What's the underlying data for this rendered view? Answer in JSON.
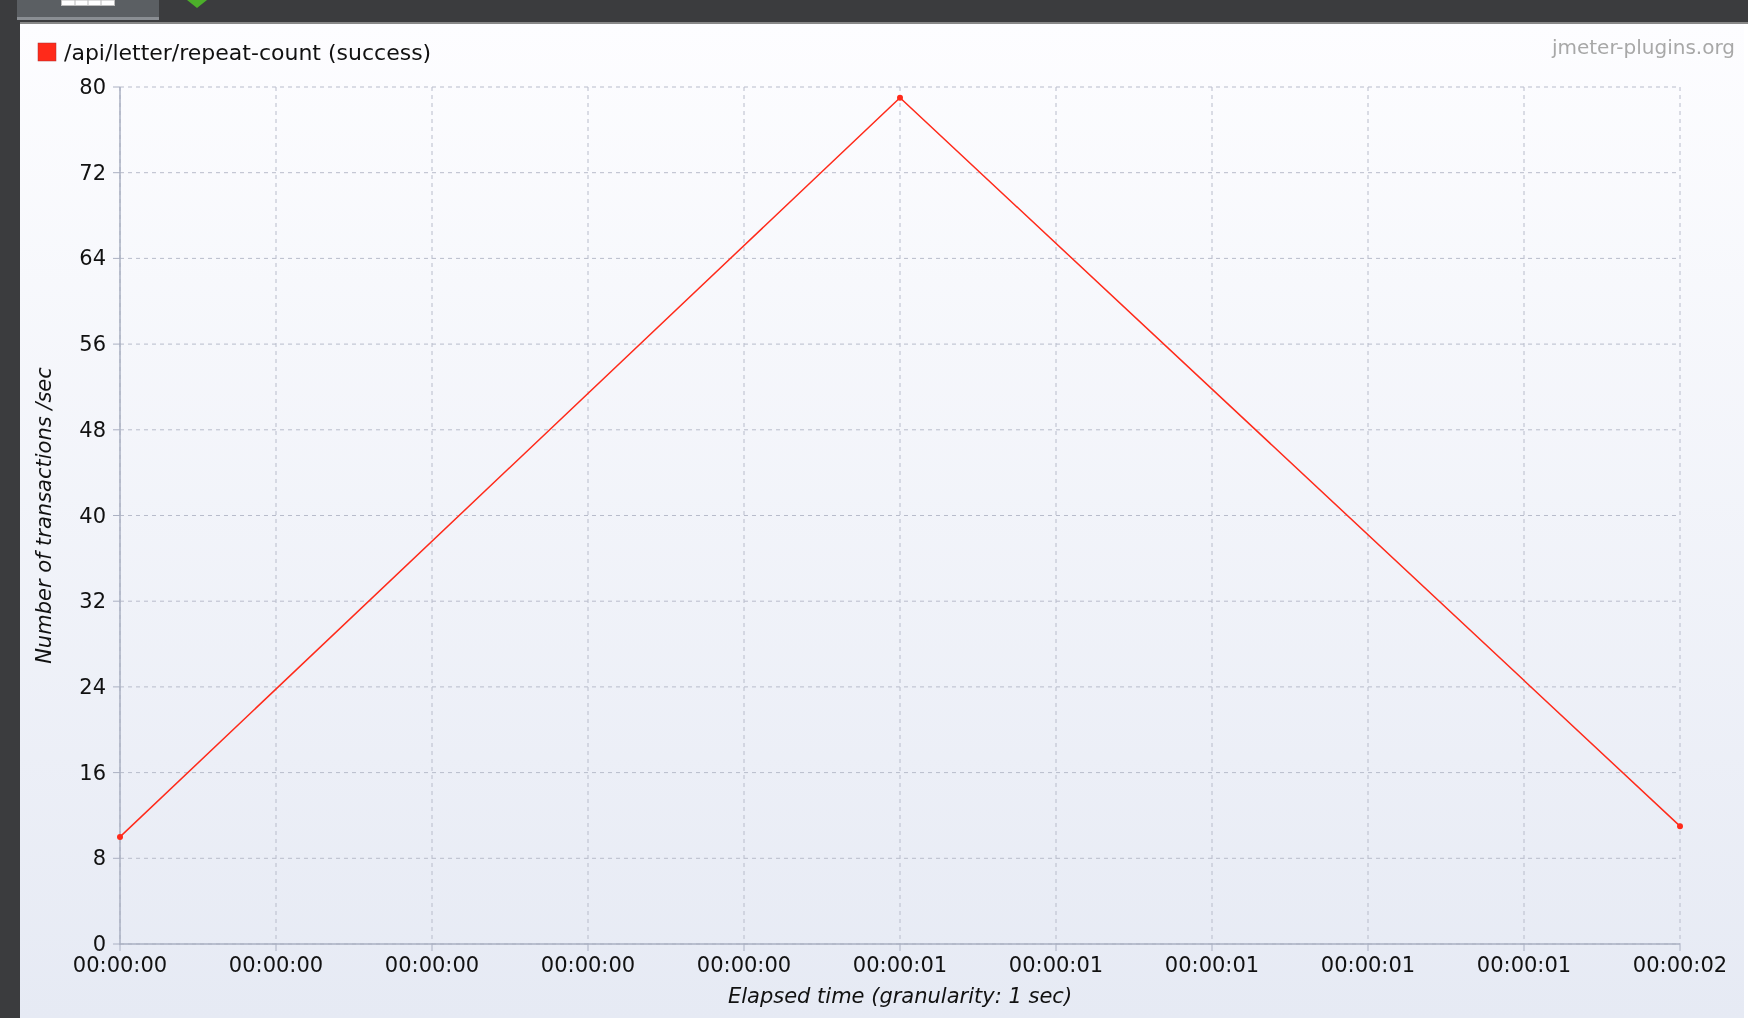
{
  "top_bar": {
    "tabs": [
      {
        "kind": "table",
        "selected": true
      },
      {
        "kind": "status",
        "selected": false
      }
    ]
  },
  "graph": {
    "watermark": "jmeter-plugins.org",
    "chart_data": {
      "type": "line",
      "xlabel": "Elapsed time (granularity: 1 sec)",
      "ylabel": "Number of transactions /sec",
      "categories": [
        "00:00:00",
        "00:00:00",
        "00:00:00",
        "00:00:00",
        "00:00:00",
        "00:00:01",
        "00:00:01",
        "00:00:01",
        "00:00:01",
        "00:00:01",
        "00:00:02"
      ],
      "series": [
        {
          "name": "/api/letter/repeat-count (success)",
          "color": "#ff2a1a",
          "marker": "circle",
          "values": [
            10,
            null,
            null,
            null,
            null,
            79,
            null,
            null,
            null,
            null,
            11
          ]
        }
      ],
      "ylim": [
        0,
        80
      ],
      "grid": true,
      "yticks": [
        0,
        8,
        16,
        24,
        32,
        40,
        48,
        56,
        64,
        72,
        80
      ]
    }
  }
}
